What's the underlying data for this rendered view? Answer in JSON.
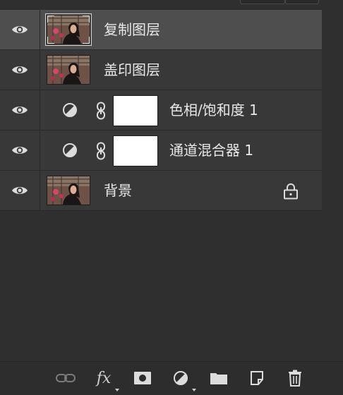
{
  "panel": "layers",
  "colors": {
    "panel_bg": "#2f2f2f",
    "row_bg": "#383838",
    "row_selected_bg": "#4e4e4e",
    "text": "#e8e8e8",
    "icon": "#cfcfcf"
  },
  "layers": [
    {
      "name": "复制图层",
      "kind": "pixel",
      "selected": true,
      "visible": true
    },
    {
      "name": "盖印图层",
      "kind": "pixel",
      "selected": false,
      "visible": true
    },
    {
      "name": "色相/饱和度 1",
      "kind": "adjustment",
      "selected": false,
      "visible": true
    },
    {
      "name": "通道混合器 1",
      "kind": "adjustment",
      "selected": false,
      "visible": true
    },
    {
      "name": "背景",
      "kind": "background",
      "selected": false,
      "visible": true,
      "locked": true
    }
  ],
  "toolbar": {
    "items": [
      "link-layers",
      "fx",
      "add-mask",
      "new-adjustment",
      "new-group",
      "new-layer",
      "delete-layer"
    ],
    "fx_label": "fx"
  }
}
